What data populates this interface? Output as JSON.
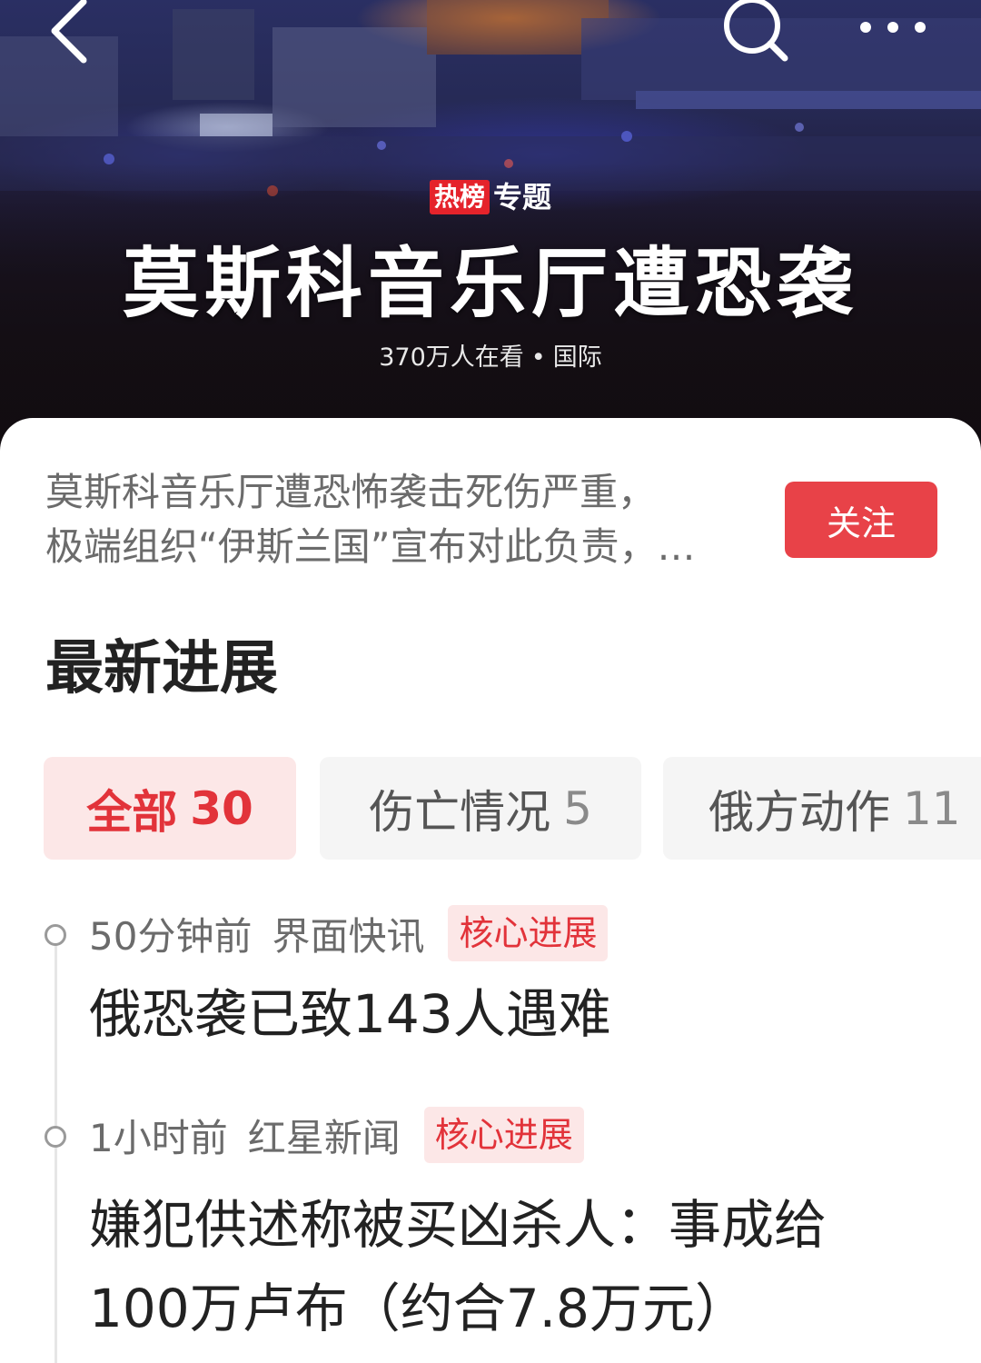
{
  "topic": {
    "badge": "热榜",
    "label": "专题",
    "title": "莫斯科音乐厅遭恐袭",
    "viewers": "370万人在看",
    "separator": "•",
    "category": "国际"
  },
  "nav": {
    "back_icon": "chevron-left-icon",
    "search_icon": "search-icon",
    "more_icon": "more-horizontal-icon"
  },
  "summary": {
    "line1": "莫斯科音乐厅遭恐怖袭击死伤严重，",
    "line2": "极端组织“伊斯兰国”宣布对此负责，…",
    "follow_label": "关注"
  },
  "section": {
    "title": "最新进展"
  },
  "tabs": [
    {
      "label": "全部",
      "count": "30",
      "selected": true
    },
    {
      "label": "伤亡情况",
      "count": "5",
      "selected": false
    },
    {
      "label": "俄方动作",
      "count": "11",
      "selected": false
    }
  ],
  "timeline": [
    {
      "time": "50分钟前",
      "source": "界面快讯",
      "tag": "核心进展",
      "headline_line1": "俄恐袭已致143人遇难",
      "headline_line2": ""
    },
    {
      "time": "1小时前",
      "source": "红星新闻",
      "tag": "核心进展",
      "headline_line1": "嫌犯供述称被买凶杀人：事成给",
      "headline_line2": "100万卢布（约合7.8万元）"
    }
  ],
  "colors": {
    "accent": "#e84248",
    "accent_light": "#fce7e7",
    "hot_badge": "#e5232b"
  }
}
